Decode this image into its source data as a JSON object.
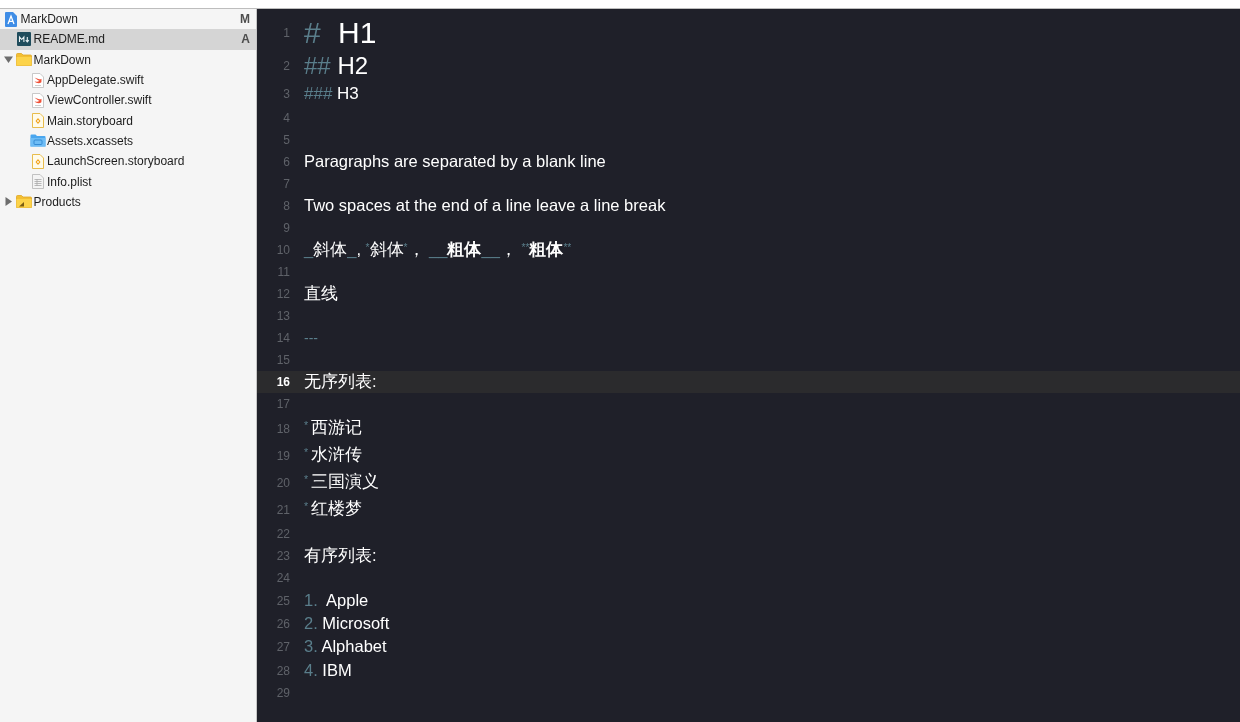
{
  "navigator": {
    "items": [
      {
        "kind": "project",
        "name": "MarkDown",
        "status": "M",
        "selected": false,
        "children": [
          {
            "kind": "markdown",
            "name": "README.md",
            "status": "A",
            "selected": true
          },
          {
            "kind": "folder",
            "name": "MarkDown",
            "expanded": true,
            "selected": false,
            "children": [
              {
                "kind": "swift",
                "name": "AppDelegate.swift",
                "selected": false
              },
              {
                "kind": "swift",
                "name": "ViewController.swift",
                "selected": false
              },
              {
                "kind": "storyboard",
                "name": "Main.storyboard",
                "selected": false
              },
              {
                "kind": "asset-catalog",
                "name": "Assets.xcassets",
                "selected": false
              },
              {
                "kind": "storyboard",
                "name": "LaunchScreen.storyboard",
                "selected": false
              },
              {
                "kind": "plist",
                "name": "Info.plist",
                "selected": false
              }
            ]
          },
          {
            "kind": "products-folder",
            "name": "Products",
            "expanded": false,
            "selected": false
          }
        ]
      }
    ]
  },
  "editor": {
    "lines": [
      {
        "number": "1",
        "kind": "heading1",
        "current": false,
        "segments": [
          {
            "kind": "marker",
            "text": "# "
          },
          {
            "kind": "text",
            "text": "H1"
          }
        ]
      },
      {
        "number": "2",
        "kind": "heading2",
        "current": false,
        "segments": [
          {
            "kind": "marker",
            "text": "## "
          },
          {
            "kind": "text",
            "text": "H2"
          }
        ]
      },
      {
        "number": "3",
        "kind": "heading3",
        "current": false,
        "segments": [
          {
            "kind": "marker",
            "text": "### "
          },
          {
            "kind": "text",
            "text": "H3"
          }
        ]
      },
      {
        "number": "4",
        "kind": "blank",
        "current": false
      },
      {
        "number": "5",
        "kind": "blank",
        "current": false
      },
      {
        "number": "6",
        "kind": "paragraph",
        "current": false,
        "segments": [
          {
            "kind": "text",
            "text": "Paragraphs are separated by a blank line"
          }
        ]
      },
      {
        "number": "7",
        "kind": "blank",
        "current": false
      },
      {
        "number": "8",
        "kind": "paragraph",
        "current": false,
        "segments": [
          {
            "kind": "text",
            "text": "Two spaces at the end of a line leave a line break"
          }
        ]
      },
      {
        "number": "9",
        "kind": "blank",
        "current": false
      },
      {
        "number": "10",
        "kind": "paragraph",
        "current": false,
        "segments": [
          {
            "kind": "marker",
            "text": "_"
          },
          {
            "kind": "text",
            "text": "斜体"
          },
          {
            "kind": "marker",
            "text": "_"
          },
          {
            "kind": "text",
            "text": ", "
          },
          {
            "kind": "small-marker",
            "text": "*"
          },
          {
            "kind": "text",
            "text": "斜体"
          },
          {
            "kind": "small-marker",
            "text": "*"
          },
          {
            "kind": "text",
            "text": "， "
          },
          {
            "kind": "marker",
            "text": "__"
          },
          {
            "kind": "strong",
            "text": "粗体"
          },
          {
            "kind": "marker",
            "text": "__"
          },
          {
            "kind": "text",
            "text": "， "
          },
          {
            "kind": "small-marker",
            "text": "**"
          },
          {
            "kind": "strong",
            "text": "粗体"
          },
          {
            "kind": "small-marker",
            "text": "**"
          }
        ]
      },
      {
        "number": "11",
        "kind": "blank",
        "current": false
      },
      {
        "number": "12",
        "kind": "paragraph",
        "current": false,
        "segments": [
          {
            "kind": "text",
            "text": "直线"
          }
        ]
      },
      {
        "number": "13",
        "kind": "blank",
        "current": false
      },
      {
        "number": "14",
        "kind": "rule",
        "current": false,
        "segments": [
          {
            "kind": "marker",
            "text": "---"
          }
        ]
      },
      {
        "number": "15",
        "kind": "blank",
        "current": false
      },
      {
        "number": "16",
        "kind": "paragraph",
        "current": true,
        "segments": [
          {
            "kind": "text",
            "text": "无序列表:"
          }
        ]
      },
      {
        "number": "17",
        "kind": "blank",
        "current": false
      },
      {
        "number": "18",
        "kind": "bullet",
        "current": false,
        "segments": [
          {
            "kind": "small-marker",
            "text": "* "
          },
          {
            "kind": "text",
            "text": "西游记"
          }
        ]
      },
      {
        "number": "19",
        "kind": "bullet",
        "current": false,
        "segments": [
          {
            "kind": "small-marker",
            "text": "* "
          },
          {
            "kind": "text",
            "text": "水浒传"
          }
        ]
      },
      {
        "number": "20",
        "kind": "bullet",
        "current": false,
        "segments": [
          {
            "kind": "small-marker",
            "text": "* "
          },
          {
            "kind": "text",
            "text": "三国演义"
          }
        ]
      },
      {
        "number": "21",
        "kind": "bullet",
        "current": false,
        "segments": [
          {
            "kind": "small-marker",
            "text": "* "
          },
          {
            "kind": "text",
            "text": "红楼梦"
          }
        ]
      },
      {
        "number": "22",
        "kind": "blank",
        "current": false
      },
      {
        "number": "23",
        "kind": "paragraph",
        "current": false,
        "segments": [
          {
            "kind": "text",
            "text": "有序列表:"
          }
        ]
      },
      {
        "number": "24",
        "kind": "blank",
        "current": false
      },
      {
        "number": "25",
        "kind": "ordered",
        "current": false,
        "segments": [
          {
            "kind": "marker",
            "text": "1. "
          },
          {
            "kind": "text",
            "text": " Apple"
          }
        ]
      },
      {
        "number": "26",
        "kind": "ordered",
        "current": false,
        "segments": [
          {
            "kind": "marker",
            "text": "2. "
          },
          {
            "kind": "text",
            "text": "Microsoft"
          }
        ]
      },
      {
        "number": "27",
        "kind": "ordered",
        "current": false,
        "segments": [
          {
            "kind": "marker",
            "text": "3. "
          },
          {
            "kind": "text",
            "text": "Alphabet"
          }
        ]
      },
      {
        "number": "28",
        "kind": "ordered",
        "current": false,
        "segments": [
          {
            "kind": "marker",
            "text": "4. "
          },
          {
            "kind": "text",
            "text": "IBM"
          }
        ]
      },
      {
        "number": "29",
        "kind": "blank",
        "current": false
      }
    ]
  }
}
